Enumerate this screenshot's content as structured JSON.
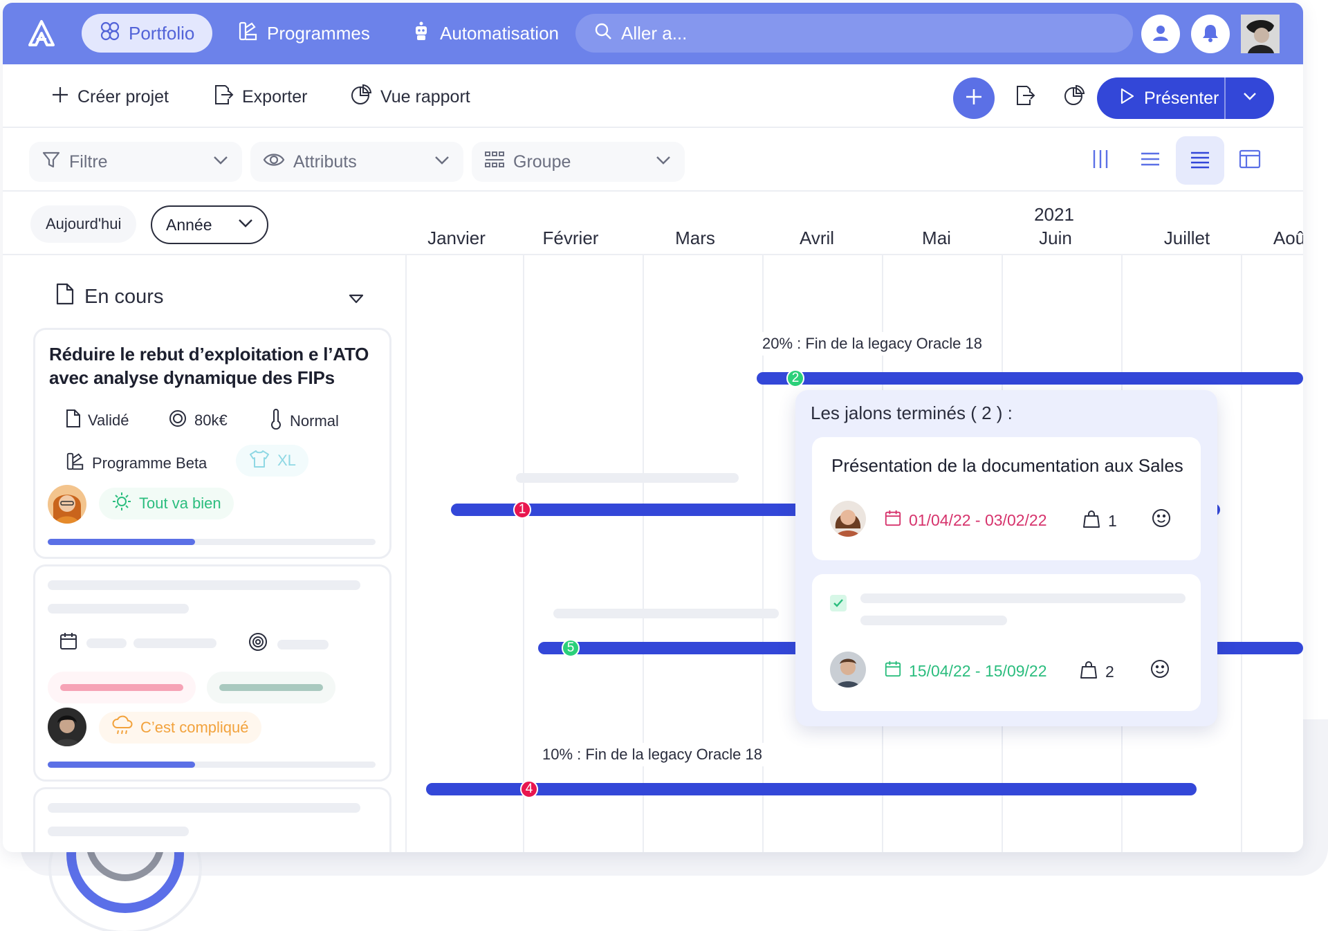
{
  "nav": {
    "items": [
      {
        "label": "Portfolio",
        "active": true
      },
      {
        "label": "Programmes",
        "active": false
      },
      {
        "label": "Automatisation",
        "active": false
      }
    ],
    "search_placeholder": "Aller a..."
  },
  "toolbar": {
    "create_label": "Créer projet",
    "export_label": "Exporter",
    "report_label": "Vue rapport",
    "present_label": "Présenter"
  },
  "filters": {
    "filter_label": "Filtre",
    "attributes_label": "Attributs",
    "group_label": "Groupe"
  },
  "timeline": {
    "today_label": "Aujourd'hui",
    "scale_label": "Année",
    "year": "2021",
    "months": [
      "Janvier",
      "Février",
      "Mars",
      "Avril",
      "Mai",
      "Juin",
      "Juillet",
      "Aoû"
    ]
  },
  "left_panel": {
    "section_title": "En cours",
    "card1": {
      "title": "Réduire le rebut d’exploitation e l’ATO avec analyse dynamique des FIPs",
      "status": "Validé",
      "budget": "80k€",
      "priority": "Normal",
      "programme": "Programme Beta",
      "size": "XL",
      "health": "Tout va bien",
      "progress": 0.45
    },
    "card2": {
      "health": "C’est compliqué",
      "progress": 0.45
    }
  },
  "gantt": {
    "labels": {
      "bar1": "20% : Fin de la legacy Oracle 18",
      "bar4": "10% : Fin de la legacy Oracle 18"
    },
    "markers": [
      "2",
      "1",
      "5",
      "4"
    ]
  },
  "popover": {
    "title": "Les jalons terminés ( 2 ) :",
    "items": [
      {
        "title": "Présentation de la documentation aux Sales",
        "dates": "01/04/22 - 03/02/22",
        "count": "1"
      },
      {
        "title": "",
        "dates": "15/04/22 - 15/09/22",
        "count": "2"
      }
    ]
  },
  "colors": {
    "nav_bg": "#6c82ea",
    "accent": "#3347d8",
    "marker_red": "#e8164f",
    "marker_green": "#2bd07a",
    "health_good": "#2bbd7e",
    "health_bad": "#f2a23c"
  }
}
